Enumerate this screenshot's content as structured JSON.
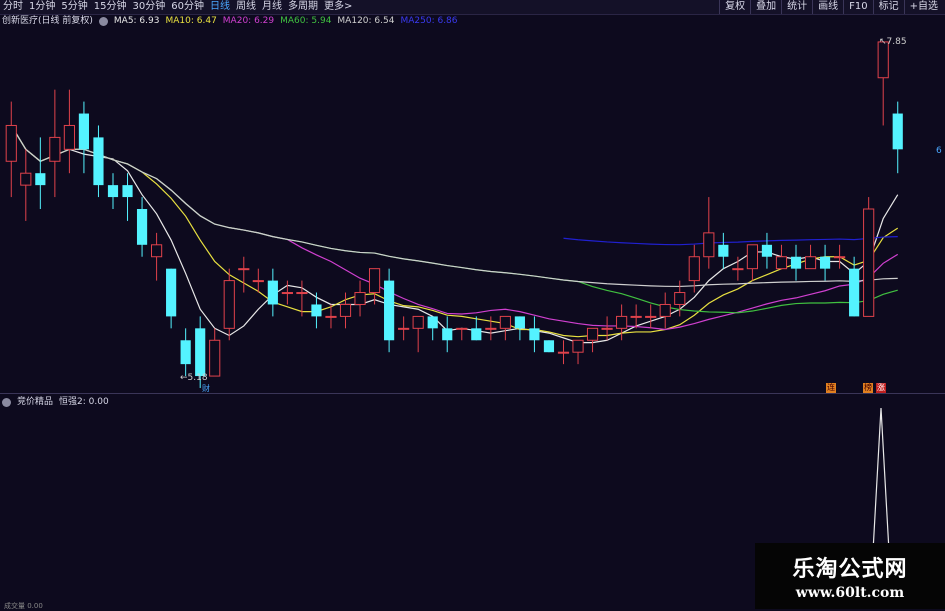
{
  "topbar": {
    "tabs": [
      "分时",
      "1分钟",
      "5分钟",
      "15分钟",
      "30分钟",
      "60分钟",
      "日线",
      "周线",
      "月线",
      "多周期",
      "更多>"
    ],
    "active_tab": "日线",
    "tools": [
      "复权",
      "叠加",
      "统计",
      "画线",
      "F10",
      "标记",
      "+自选"
    ]
  },
  "info": {
    "stock_name": "创新医疗(日线 前复权)",
    "ma5": "MA5: 6.93",
    "ma10": "MA10: 6.47",
    "ma20": "MA20: 6.29",
    "ma60": "MA60: 5.94",
    "ma120": "MA120: 6.54",
    "ma250": "MA250: 6.86"
  },
  "colors": {
    "up": "#e0424b",
    "down": "#54f3ff",
    "ma5": "#e8e8e8",
    "ma10": "#e8e040",
    "ma20": "#d040d0",
    "ma60": "#40c040",
    "ma120": "#cfcfcf",
    "ma250": "#2020d0"
  },
  "chart_labels": {
    "low": "←5.18",
    "high": "↖7.85",
    "right_price": "6",
    "cai": "财",
    "badges": [
      "连",
      "榜",
      "涨"
    ]
  },
  "indicator": {
    "name": "竞价精品",
    "value": "恒强2: 0.00"
  },
  "watermark": {
    "title": "乐淘公式网",
    "url": "www.60lt.com"
  },
  "bottom_label": "成交量 0.00",
  "chart_data": {
    "type": "candlestick",
    "y_range": [
      5.0,
      8.0
    ],
    "candles": [
      [
        6.9,
        7.2,
        7.4,
        6.6
      ],
      [
        6.7,
        6.8,
        7.0,
        6.4
      ],
      [
        6.8,
        6.7,
        7.1,
        6.5
      ],
      [
        6.9,
        7.1,
        7.5,
        6.6
      ],
      [
        7.0,
        7.2,
        7.5,
        6.8
      ],
      [
        7.3,
        7.0,
        7.4,
        6.8
      ],
      [
        7.1,
        6.7,
        7.2,
        6.6
      ],
      [
        6.7,
        6.6,
        6.8,
        6.5
      ],
      [
        6.7,
        6.6,
        6.8,
        6.4
      ],
      [
        6.5,
        6.2,
        6.6,
        6.1
      ],
      [
        6.1,
        6.2,
        6.3,
        5.9
      ],
      [
        6.0,
        5.6,
        6.0,
        5.5
      ],
      [
        5.4,
        5.2,
        5.5,
        5.1
      ],
      [
        5.5,
        5.1,
        5.6,
        5.0
      ],
      [
        5.1,
        5.4,
        5.5,
        5.1
      ],
      [
        5.5,
        5.9,
        6.0,
        5.4
      ],
      [
        6.0,
        6.0,
        6.1,
        5.8
      ],
      [
        5.9,
        5.9,
        6.0,
        5.8
      ],
      [
        5.9,
        5.7,
        6.0,
        5.6
      ],
      [
        5.8,
        5.8,
        5.9,
        5.7
      ],
      [
        5.8,
        5.8,
        5.9,
        5.6
      ],
      [
        5.7,
        5.6,
        5.8,
        5.5
      ],
      [
        5.6,
        5.6,
        5.7,
        5.5
      ],
      [
        5.6,
        5.7,
        5.8,
        5.5
      ],
      [
        5.7,
        5.8,
        5.9,
        5.6
      ],
      [
        5.8,
        6.0,
        6.0,
        5.7
      ],
      [
        5.9,
        5.4,
        6.0,
        5.3
      ],
      [
        5.5,
        5.5,
        5.6,
        5.4
      ],
      [
        5.5,
        5.6,
        5.6,
        5.3
      ],
      [
        5.6,
        5.5,
        5.6,
        5.4
      ],
      [
        5.5,
        5.4,
        5.6,
        5.3
      ],
      [
        5.5,
        5.5,
        5.5,
        5.4
      ],
      [
        5.5,
        5.4,
        5.6,
        5.4
      ],
      [
        5.5,
        5.5,
        5.6,
        5.4
      ],
      [
        5.5,
        5.6,
        5.6,
        5.4
      ],
      [
        5.6,
        5.5,
        5.6,
        5.4
      ],
      [
        5.5,
        5.4,
        5.6,
        5.3
      ],
      [
        5.4,
        5.3,
        5.4,
        5.3
      ],
      [
        5.3,
        5.3,
        5.4,
        5.2
      ],
      [
        5.3,
        5.4,
        5.4,
        5.2
      ],
      [
        5.4,
        5.5,
        5.5,
        5.3
      ],
      [
        5.5,
        5.5,
        5.6,
        5.4
      ],
      [
        5.5,
        5.6,
        5.7,
        5.4
      ],
      [
        5.6,
        5.6,
        5.7,
        5.5
      ],
      [
        5.6,
        5.6,
        5.7,
        5.5
      ],
      [
        5.6,
        5.7,
        5.8,
        5.5
      ],
      [
        5.7,
        5.8,
        5.9,
        5.6
      ],
      [
        5.9,
        6.1,
        6.2,
        5.8
      ],
      [
        6.1,
        6.3,
        6.6,
        6.0
      ],
      [
        6.2,
        6.1,
        6.3,
        6.0
      ],
      [
        6.0,
        6.0,
        6.1,
        5.9
      ],
      [
        6.0,
        6.2,
        6.2,
        5.9
      ],
      [
        6.2,
        6.1,
        6.3,
        6.0
      ],
      [
        6.0,
        6.1,
        6.2,
        6.0
      ],
      [
        6.1,
        6.0,
        6.2,
        5.9
      ],
      [
        6.0,
        6.1,
        6.2,
        6.0
      ],
      [
        6.1,
        6.0,
        6.2,
        5.9
      ],
      [
        6.1,
        6.1,
        6.2,
        6.0
      ],
      [
        6.0,
        5.6,
        6.1,
        5.6
      ],
      [
        5.6,
        6.5,
        6.6,
        5.6
      ],
      [
        7.6,
        7.9,
        7.9,
        7.2
      ],
      [
        7.3,
        7.0,
        7.4,
        6.8
      ]
    ]
  }
}
